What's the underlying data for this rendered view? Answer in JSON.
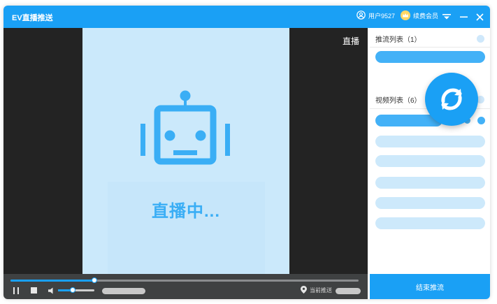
{
  "window": {
    "title": "EV直播推送"
  },
  "header": {
    "username": "用户9527",
    "vip_label": "续费会员"
  },
  "player": {
    "status_text": "直播中...",
    "live_badge": "直播",
    "progress": 0.24,
    "volume": 0.4
  },
  "bottom_bar": {
    "location_label": "当前推送"
  },
  "sidebar": {
    "push_list_title": "推流列表（1）",
    "video_list_title": "视频列表（6）"
  },
  "actions": {
    "end_push_label": "结束推流"
  },
  "colors": {
    "accent": "#1aa0f5",
    "stage": "#cbe9fb",
    "live_text": "#3aaef5",
    "player_bg": "#232323",
    "controls_bg": "#3f4142"
  }
}
